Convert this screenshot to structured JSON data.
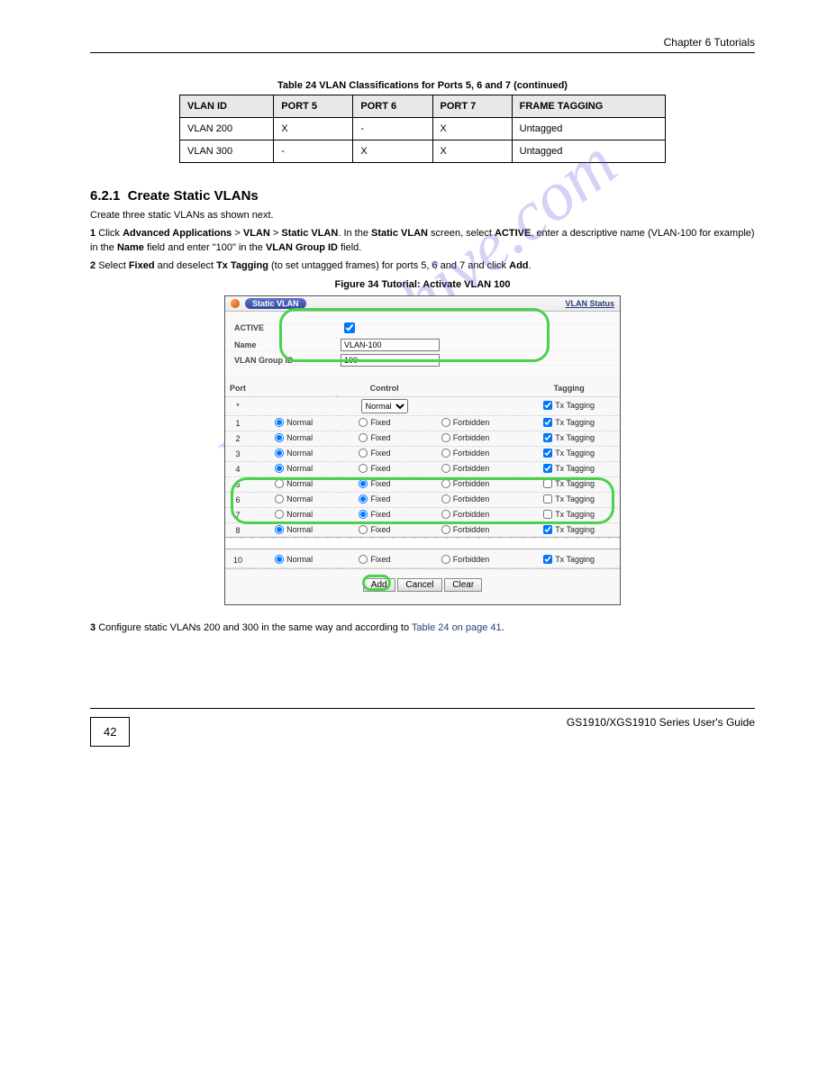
{
  "header": {
    "chapter": "Chapter 6 Tutorials"
  },
  "footer": {
    "guide": "GS1910/XGS1910 Series User's Guide"
  },
  "page_number": "42",
  "table24": {
    "title": "Table 24   VLAN Classifications for Ports 5, 6 and 7 (continued)",
    "headers": [
      "VLAN ID",
      "PORT 5",
      "PORT 6",
      "PORT 7",
      "FRAME TAGGING"
    ],
    "rows": [
      [
        "VLAN 200",
        "X",
        "-",
        "X",
        "Untagged"
      ],
      [
        "VLAN 300",
        "-",
        "X",
        "X",
        "Untagged"
      ]
    ]
  },
  "section": {
    "num": "6.2.1",
    "title": "Create Static VLANs",
    "intro": "Create three static VLANs as shown next.",
    "steps": {
      "s1a": "Click ",
      "s1b": "Advanced Applications",
      "s1c": " > ",
      "s1d": "VLAN",
      "s1e": " > ",
      "s1f": "Static VLAN",
      "s1g": ". In the ",
      "s1h": " screen, select ",
      "s1i": "ACTIVE",
      "s1j": ", enter a descriptive name (VLAN-100 for example) in the ",
      "s1k": "Name",
      "s1l": " field and enter \"100\" in the ",
      "s1m": "VLAN Group ID",
      "s1n": " field.",
      "s2": "Select Fixed and deselect Tx Tagging (to set untagged frames) for ports 5, 6 and 7 and click Add.",
      "s2_a": "Select ",
      "s2_b": "Fixed",
      "s2_c": " and deselect ",
      "s2_d": "Tx Tagging",
      "s2_e": " (to set untagged frames) for ports 5, 6 and 7 and click ",
      "s2_f": "Add",
      "s2_g": ".",
      "s3a": "Configure static VLANs 200 and 300 in the same way and according to ",
      "s3b": "Table 24 on page 41",
      "s3c": "."
    }
  },
  "figure": {
    "title": "Figure 34   Tutorial: Activate VLAN 100"
  },
  "shot": {
    "panel_title": "Static VLAN",
    "link": "VLAN Status",
    "labels": {
      "active": "ACTIVE",
      "name": "Name",
      "vlan_group": "VLAN Group ID"
    },
    "values": {
      "name": "VLAN-100",
      "vlan_group": "100"
    },
    "cols": {
      "port": "Port",
      "control": "Control",
      "tagging": "Tagging"
    },
    "control_opts": {
      "normal": "Normal",
      "fixed": "Fixed",
      "forbidden": "Forbidden"
    },
    "tag_label": "Tx Tagging",
    "ports": [
      {
        "n": "*",
        "special": true
      },
      {
        "n": "1",
        "sel": "normal",
        "tag": true
      },
      {
        "n": "2",
        "sel": "normal",
        "tag": true
      },
      {
        "n": "3",
        "sel": "normal",
        "tag": true
      },
      {
        "n": "4",
        "sel": "normal",
        "tag": true
      },
      {
        "n": "5",
        "sel": "fixed",
        "tag": false
      },
      {
        "n": "6",
        "sel": "fixed",
        "tag": false
      },
      {
        "n": "7",
        "sel": "fixed",
        "tag": false
      },
      {
        "n": "8",
        "sel": "normal",
        "tag": true
      }
    ],
    "port_last": {
      "n": "10",
      "sel": "normal",
      "tag": true
    },
    "buttons": {
      "add": "Add",
      "cancel": "Cancel",
      "clear": "Clear"
    }
  },
  "watermark": "manualshive.com"
}
